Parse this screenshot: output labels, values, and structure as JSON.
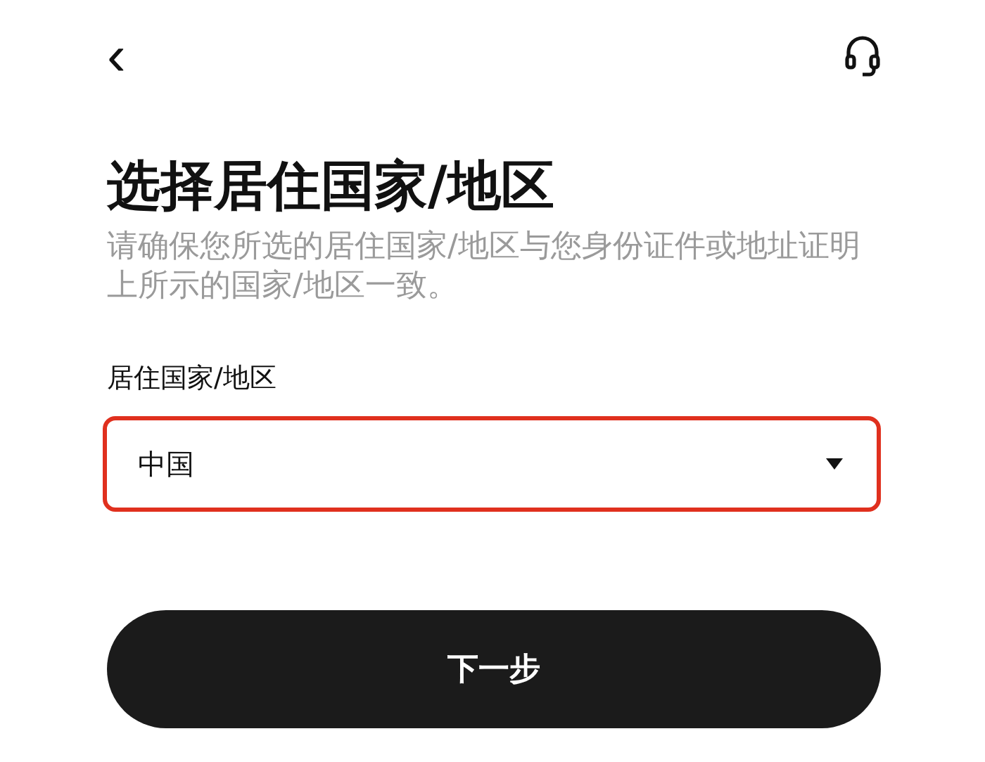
{
  "header": {
    "back": "‹"
  },
  "title": "选择居住国家/地区",
  "description": "请确保您所选的居住国家/地区与您身份证件或地址证明上所示的国家/地区一致。",
  "field": {
    "label": "居住国家/地区",
    "value": "中国",
    "highlighted": true
  },
  "next_button": "下一步"
}
